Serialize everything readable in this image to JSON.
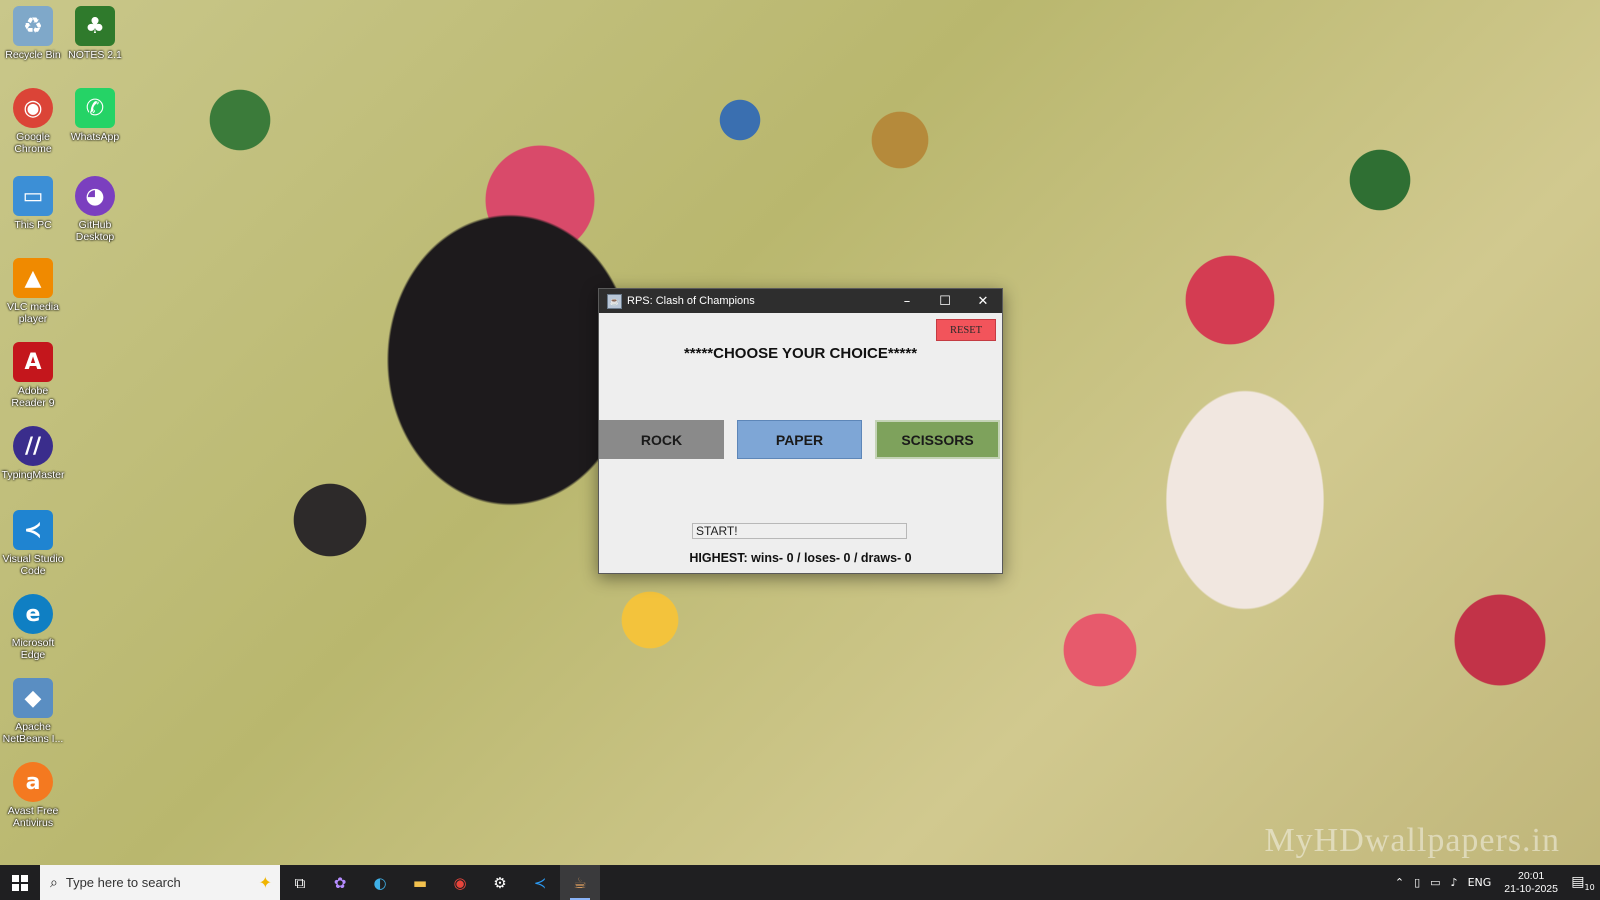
{
  "desktop": {
    "icons": [
      {
        "label": "Recycle Bin",
        "icon": "recycle-bin-icon",
        "glyph": "♻",
        "color": "#7fa8c9"
      },
      {
        "label": "NOTES 2.1",
        "icon": "tree-icon",
        "glyph": "♣",
        "color": "#2f7a2c"
      },
      {
        "label": "Google Chrome",
        "icon": "chrome-icon",
        "glyph": "◉",
        "color": "#db4437"
      },
      {
        "label": "WhatsApp",
        "icon": "whatsapp-icon",
        "glyph": "✆",
        "color": "#25d366"
      },
      {
        "label": "This PC",
        "icon": "computer-icon",
        "glyph": "▭",
        "color": "#3c8fd6"
      },
      {
        "label": "GitHub Desktop",
        "icon": "github-icon",
        "glyph": "◕",
        "color": "#7b3fbf"
      },
      {
        "label": "VLC media player",
        "icon": "vlc-icon",
        "glyph": "▲",
        "color": "#f08a00"
      },
      {
        "label": "Adobe Reader 9",
        "icon": "adobe-reader-icon",
        "glyph": "A",
        "color": "#c4161c"
      },
      {
        "label": "TypingMaster",
        "icon": "typingmaster-icon",
        "glyph": "//",
        "color": "#3a2d8c"
      },
      {
        "label": "Visual Studio Code",
        "icon": "vscode-icon",
        "glyph": "≺",
        "color": "#1f84d1"
      },
      {
        "label": "Microsoft Edge",
        "icon": "edge-icon",
        "glyph": "e",
        "color": "#0f7fc3"
      },
      {
        "label": "Apache NetBeans I...",
        "icon": "netbeans-icon",
        "glyph": "◆",
        "color": "#5a8ec2"
      },
      {
        "label": "Avast Free Antivirus",
        "icon": "avast-icon",
        "glyph": "a",
        "color": "#f47920"
      }
    ],
    "watermark": "MyHDwallpapers.in"
  },
  "window": {
    "title": "RPS: Clash of Champions",
    "controls": {
      "minimize": "–",
      "maximize": "☐",
      "close": "✕"
    },
    "reset_label": "RESET",
    "heading": "*****CHOOSE YOUR CHOICE*****",
    "choices": {
      "rock": "ROCK",
      "paper": "PAPER",
      "scissors": "SCISSORS"
    },
    "status": "START!",
    "highest": "HIGHEST: wins- 0 / loses- 0 / draws- 0"
  },
  "taskbar": {
    "search_placeholder": "Type here to search",
    "apps": [
      {
        "name": "task-view-icon",
        "glyph": "⧉"
      },
      {
        "name": "copilot-icon",
        "glyph": "✿"
      },
      {
        "name": "edge-icon",
        "glyph": "◐"
      },
      {
        "name": "file-explorer-icon",
        "glyph": "▬"
      },
      {
        "name": "chrome-icon",
        "glyph": "◉"
      },
      {
        "name": "settings-icon",
        "glyph": "⚙"
      },
      {
        "name": "vscode-icon",
        "glyph": "≺"
      },
      {
        "name": "java-app-icon",
        "glyph": "☕"
      }
    ],
    "language": "ENG",
    "time": "20:01",
    "date": "21-10-2025",
    "notifications": "10"
  }
}
